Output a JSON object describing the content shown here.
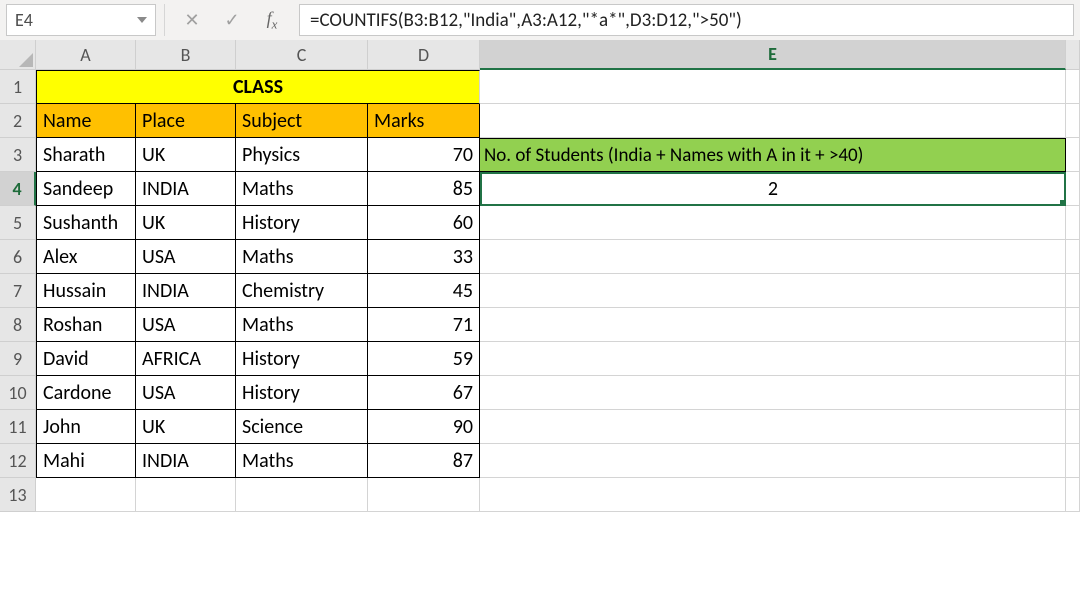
{
  "formula_bar": {
    "cell_ref": "E4",
    "formula": "=COUNTIFS(B3:B12,\"India\",A3:A12,\"*a*\",D3:D12,\">50\")",
    "fx_label_f": "f",
    "fx_label_x": "x"
  },
  "columns": [
    "A",
    "B",
    "C",
    "D",
    "E"
  ],
  "row_numbers": [
    "1",
    "2",
    "3",
    "4",
    "5",
    "6",
    "7",
    "8",
    "9",
    "10",
    "11",
    "12",
    "13"
  ],
  "selected_column": "E",
  "selected_row": "4",
  "title_cell": "CLASS",
  "headers": {
    "name": "Name",
    "place": "Place",
    "subject": "Subject",
    "marks": "Marks"
  },
  "rows": [
    {
      "name": "Sharath",
      "place": "UK",
      "subject": "Physics",
      "marks": "70"
    },
    {
      "name": "Sandeep",
      "place": "INDIA",
      "subject": "Maths",
      "marks": "85"
    },
    {
      "name": "Sushanth",
      "place": "UK",
      "subject": "History",
      "marks": "60"
    },
    {
      "name": "Alex",
      "place": "USA",
      "subject": "Maths",
      "marks": "33"
    },
    {
      "name": "Hussain",
      "place": "INDIA",
      "subject": "Chemistry",
      "marks": "45"
    },
    {
      "name": "Roshan",
      "place": "USA",
      "subject": "Maths",
      "marks": "71"
    },
    {
      "name": "David",
      "place": "AFRICA",
      "subject": "History",
      "marks": "59"
    },
    {
      "name": "Cardone",
      "place": "USA",
      "subject": "History",
      "marks": "67"
    },
    {
      "name": "John",
      "place": "UK",
      "subject": "Science",
      "marks": "90"
    },
    {
      "name": "Mahi",
      "place": "INDIA",
      "subject": "Maths",
      "marks": "87"
    }
  ],
  "result_label": "No. of Students (India + Names with A in it + >40)",
  "result_value": "2",
  "icons": {
    "cancel": "✕",
    "enter": "✓"
  }
}
